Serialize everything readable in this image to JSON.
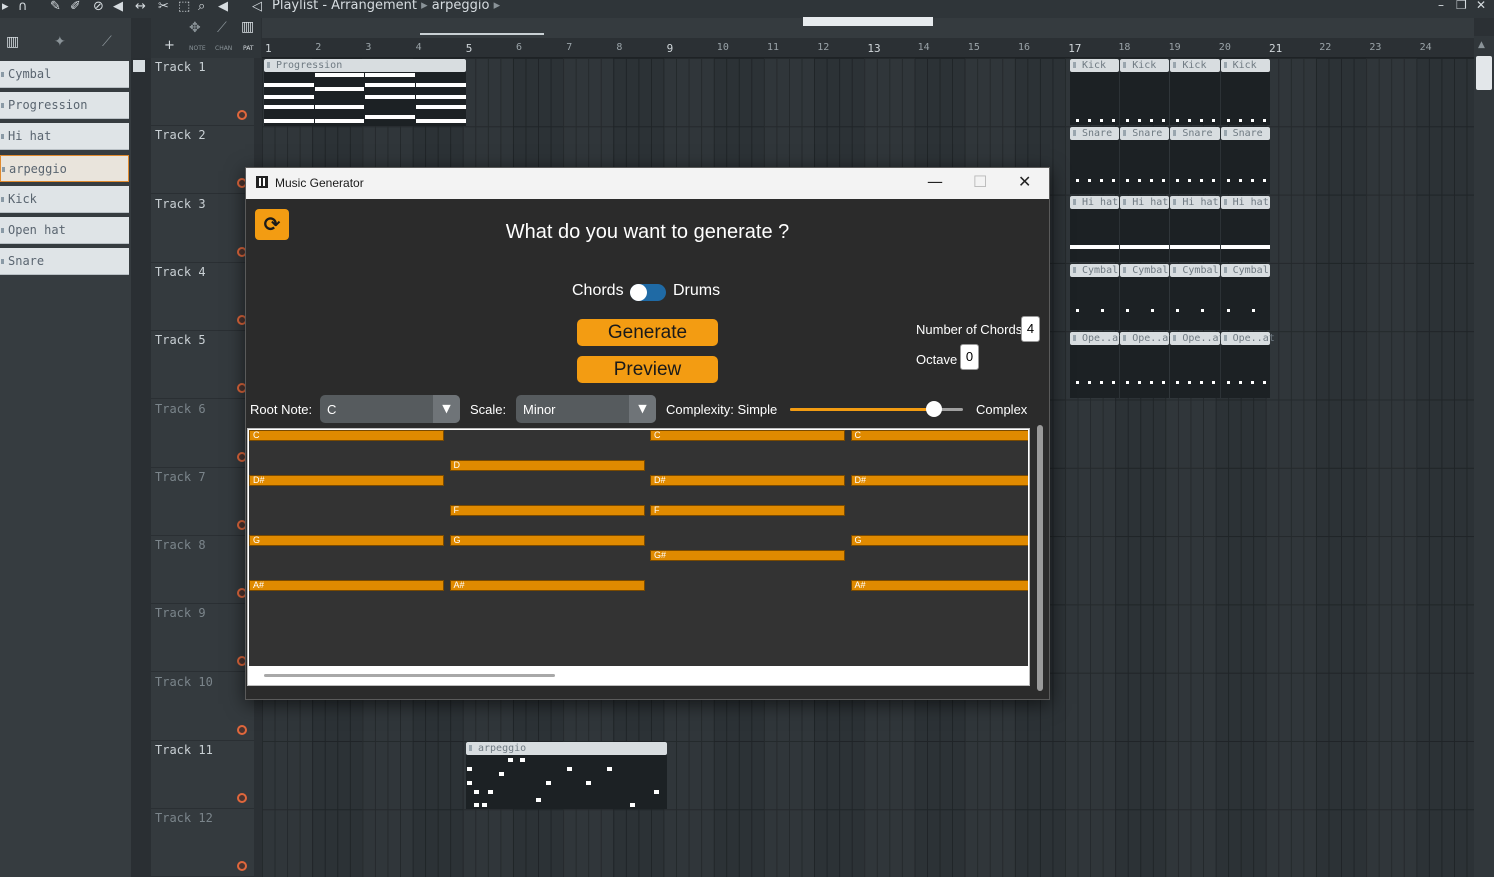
{
  "topbar": {
    "playlist_label": "Playlist - Arrangement",
    "separator": "▸",
    "current_pattern": "arpeggio",
    "separator2": "▸",
    "minimize": "–",
    "restore": "❐",
    "close": "✕"
  },
  "snap_bar": {
    "add": "+",
    "note_lbl": "NOTE",
    "chan_lbl": "CHAN",
    "pat_lbl": "PAT"
  },
  "patterns": [
    {
      "label": "Cymbal",
      "selected": false
    },
    {
      "label": "Progression",
      "selected": false
    },
    {
      "label": "Hi hat",
      "selected": false
    },
    {
      "label": "arpeggio",
      "selected": true
    },
    {
      "label": "Kick",
      "selected": false
    },
    {
      "label": "Open hat",
      "selected": false
    },
    {
      "label": "Snare",
      "selected": false
    }
  ],
  "tracks": [
    {
      "label": "Track 1",
      "dim": false
    },
    {
      "label": "Track 2",
      "dim": false
    },
    {
      "label": "Track 3",
      "dim": false
    },
    {
      "label": "Track 4",
      "dim": false
    },
    {
      "label": "Track 5",
      "dim": false
    },
    {
      "label": "Track 6",
      "dim": true
    },
    {
      "label": "Track 7",
      "dim": true
    },
    {
      "label": "Track 8",
      "dim": true
    },
    {
      "label": "Track 9",
      "dim": true
    },
    {
      "label": "Track 10",
      "dim": true
    },
    {
      "label": "Track 11",
      "dim": false
    },
    {
      "label": "Track 12",
      "dim": true
    }
  ],
  "ruler": [
    "1",
    "2",
    "3",
    "4",
    "5",
    "6",
    "7",
    "8",
    "9",
    "10",
    "11",
    "12",
    "13",
    "14",
    "15",
    "16",
    "17",
    "18",
    "19",
    "20",
    "21",
    "22",
    "23",
    "24"
  ],
  "clips": {
    "progression": "Progression",
    "arpeggio": "arpeggio",
    "kick": [
      "Kick",
      "Kick",
      "Kick",
      "Kick"
    ],
    "snare": [
      "Snare",
      "Snare",
      "Snare",
      "Snare"
    ],
    "hihat": [
      "Hi hat",
      "Hi hat",
      "Hi hat",
      "Hi hat"
    ],
    "cymbal": [
      "Cymbal",
      "Cymbal",
      "Cymbal",
      "Cymbal"
    ],
    "openhat": [
      "Ope..at",
      "Ope..at",
      "Ope..at",
      "Ope..at"
    ]
  },
  "dialog": {
    "title": "Music Generator",
    "minimize": "—",
    "maximize": "☐",
    "close": "✕",
    "refresh_icon": "⟳",
    "question": "What do you want to generate ?",
    "toggle_left": "Chords",
    "toggle_right": "Drums",
    "toggle_on": false,
    "generate_label": "Generate",
    "preview_label": "Preview",
    "num_chords_label": "Number of Chords",
    "num_chords_value": "4",
    "octave_label": "Octave",
    "octave_value": "0",
    "root_note_label": "Root Note:",
    "root_note_value": "C",
    "scale_label": "Scale:",
    "scale_value": "Minor",
    "complexity_label": "Complexity: Simple",
    "complex_label": "Complex",
    "complexity_value": 0.83,
    "accent": "#f39c12"
  },
  "chord_roll": {
    "notes": [
      {
        "chord": 0,
        "label": "C",
        "row": 0
      },
      {
        "chord": 0,
        "label": "D#",
        "row": 3
      },
      {
        "chord": 0,
        "label": "G",
        "row": 7
      },
      {
        "chord": 0,
        "label": "A#",
        "row": 10
      },
      {
        "chord": 1,
        "label": "D",
        "row": 2
      },
      {
        "chord": 1,
        "label": "F",
        "row": 5
      },
      {
        "chord": 1,
        "label": "G",
        "row": 7
      },
      {
        "chord": 1,
        "label": "A#",
        "row": 10
      },
      {
        "chord": 2,
        "label": "C",
        "row": 0
      },
      {
        "chord": 2,
        "label": "D#",
        "row": 3
      },
      {
        "chord": 2,
        "label": "F",
        "row": 5
      },
      {
        "chord": 2,
        "label": "G#",
        "row": 8
      },
      {
        "chord": 3,
        "label": "C",
        "row": 0
      },
      {
        "chord": 3,
        "label": "D#",
        "row": 3
      },
      {
        "chord": 3,
        "label": "G",
        "row": 7
      },
      {
        "chord": 3,
        "label": "A#",
        "row": 10
      }
    ]
  }
}
